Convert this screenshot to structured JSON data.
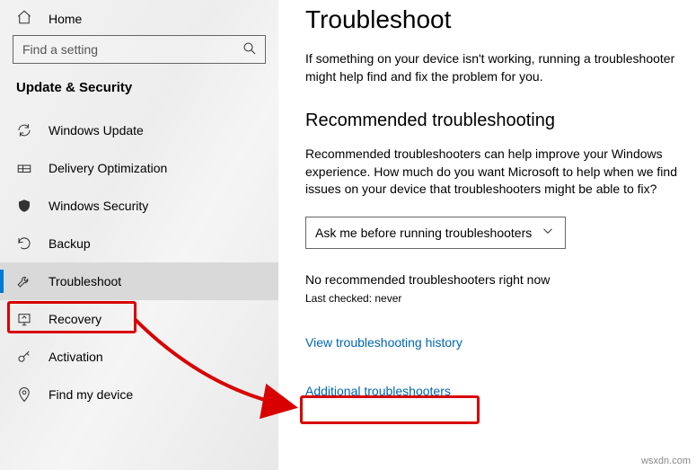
{
  "sidebar": {
    "home_label": "Home",
    "search_placeholder": "Find a setting",
    "category_title": "Update & Security",
    "items": [
      {
        "label": "Windows Update"
      },
      {
        "label": "Delivery Optimization"
      },
      {
        "label": "Windows Security"
      },
      {
        "label": "Backup"
      },
      {
        "label": "Troubleshoot"
      },
      {
        "label": "Recovery"
      },
      {
        "label": "Activation"
      },
      {
        "label": "Find my device"
      }
    ]
  },
  "main": {
    "title": "Troubleshoot",
    "intro": "If something on your device isn't working, running a troubleshooter might help find and fix the problem for you.",
    "section_title": "Recommended troubleshooting",
    "section_body": "Recommended troubleshooters can help improve your Windows experience. How much do you want Microsoft to help when we find issues on your device that troubleshooters might be able to fix?",
    "dropdown_value": "Ask me before running troubleshooters",
    "status_line": "No recommended troubleshooters right now",
    "last_checked": "Last checked: never",
    "link_history": "View troubleshooting history",
    "link_additional": "Additional troubleshooters"
  },
  "watermark": "wsxdn.com"
}
